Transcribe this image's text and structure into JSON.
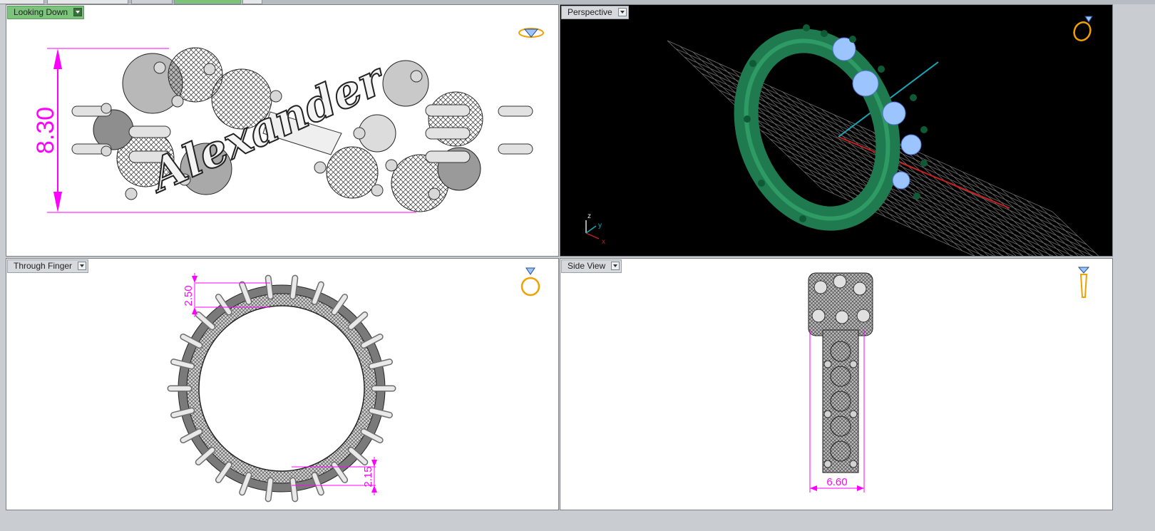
{
  "viewports": [
    {
      "label": "Looking Down",
      "active": true,
      "dimension": "8.30",
      "engraving": "Alexander"
    },
    {
      "label": "Perspective",
      "active": false,
      "axes": {
        "x": "x",
        "y": "y",
        "z": "z"
      }
    },
    {
      "label": "Through Finger",
      "active": false,
      "dimensions": [
        "2.50",
        "2.15"
      ]
    },
    {
      "label": "Side View",
      "active": false,
      "dimension": "6.60"
    }
  ],
  "icons": [
    "dropdown-arrow-icon",
    "ring-orientation-icon",
    "diamond-icon",
    "axis-gizmo-icon"
  ],
  "colors": {
    "dimension": "#ff00ff",
    "active_label": "#7cc47c",
    "ring_preview": "#1f7a4f",
    "gem_preview": "#9cc4ff",
    "grid": "#7a7a7a",
    "axis_x": "#c81e1e",
    "axis_y": "#1aa6b7",
    "icon_ring": "#f0a000"
  }
}
